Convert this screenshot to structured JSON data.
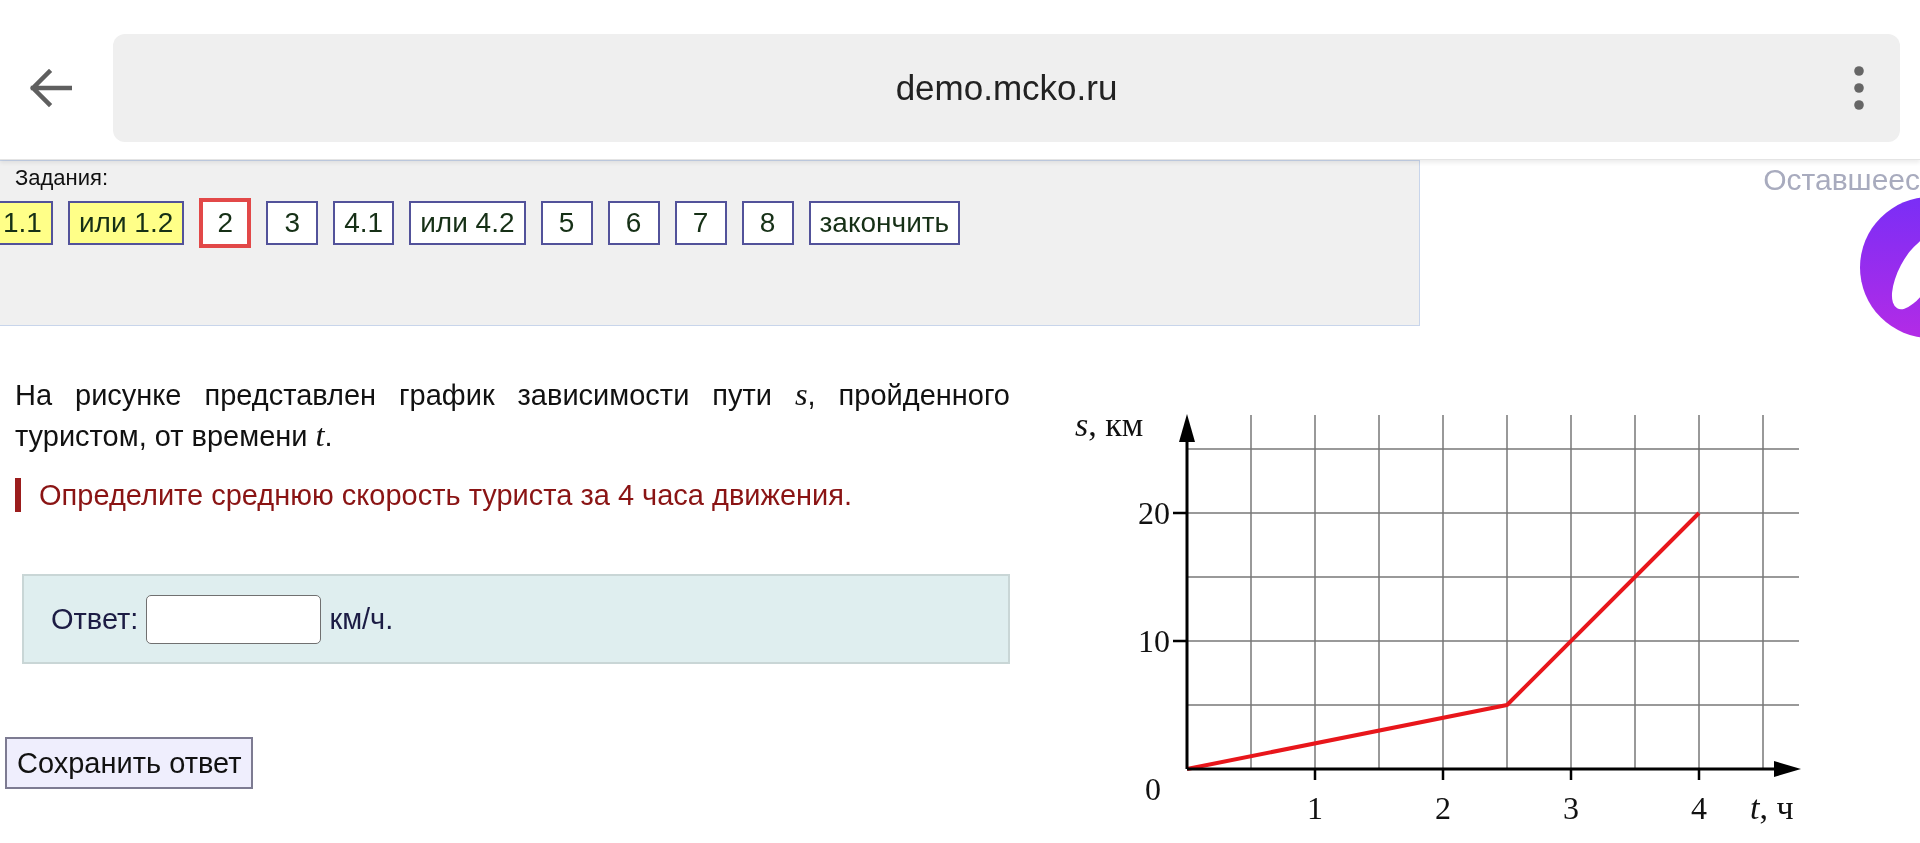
{
  "browser": {
    "url": "demo.mcko.ru"
  },
  "tasks": {
    "label": "Задания:",
    "items": [
      {
        "label": "1.1",
        "answered": true,
        "selected": false
      },
      {
        "label": "или 1.2",
        "answered": true,
        "selected": false
      },
      {
        "label": "2",
        "answered": false,
        "selected": true
      },
      {
        "label": "3",
        "answered": false,
        "selected": false
      },
      {
        "label": "4.1",
        "answered": false,
        "selected": false
      },
      {
        "label": "или 4.2",
        "answered": false,
        "selected": false
      },
      {
        "label": "5",
        "answered": false,
        "selected": false
      },
      {
        "label": "6",
        "answered": false,
        "selected": false
      },
      {
        "label": "7",
        "answered": false,
        "selected": false
      },
      {
        "label": "8",
        "answered": false,
        "selected": false
      }
    ],
    "finish_button": "закончить"
  },
  "remaining_label": "Оставшеес",
  "question": {
    "text": "На рисунке представлен график зависимости пути *s*, пройденного туристом, от времени *t*.",
    "prompt": "Определите среднюю скорость туриста за 4 часа движения.",
    "answer": {
      "label": "Ответ:",
      "unit": "км/ч."
    },
    "save_button": "Сохранить ответ",
    "chart_data": {
      "type": "line",
      "xlabel": "*t*, ч",
      "ylabel": "*s*, км",
      "x": [
        0,
        2.5,
        4
      ],
      "series": [
        {
          "color": "#e8161b",
          "values": [
            0,
            5,
            20
          ]
        }
      ],
      "xlim": [
        0,
        4.5
      ],
      "ylim": [
        0,
        25
      ],
      "xticks": [
        1,
        2,
        3,
        4
      ],
      "yticks": [
        0,
        10,
        20
      ],
      "grid": true
    }
  }
}
